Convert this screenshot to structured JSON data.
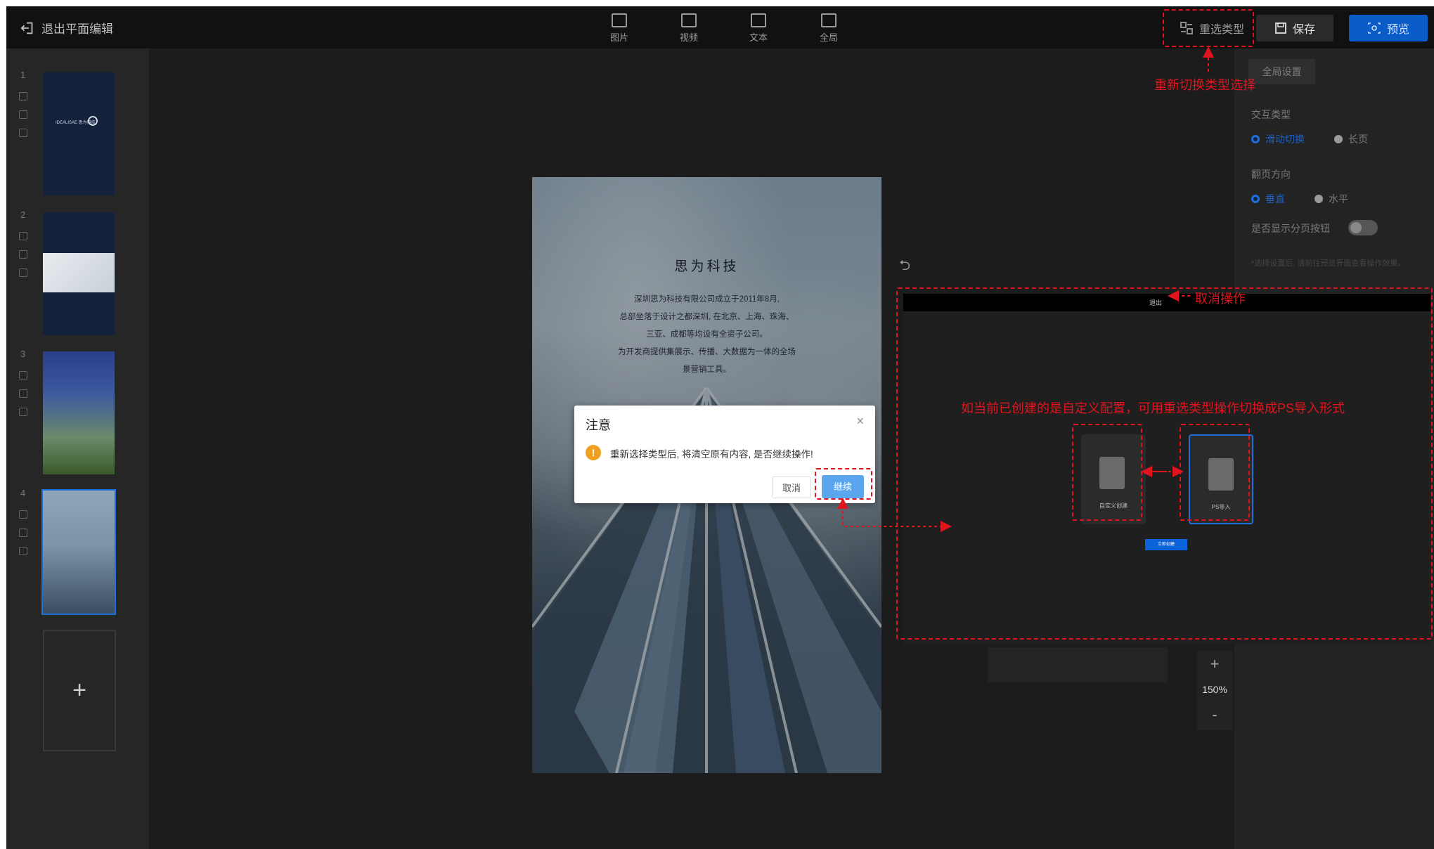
{
  "topbar": {
    "exit_label": "退出平面编辑",
    "tools": [
      {
        "label": "图片",
        "icon": "image-icon"
      },
      {
        "label": "视频",
        "icon": "video-icon"
      },
      {
        "label": "文本",
        "icon": "text-icon"
      },
      {
        "label": "全局",
        "icon": "global-icon"
      }
    ],
    "switch_type_label": "重选类型",
    "save_label": "保存",
    "preview_label": "预览"
  },
  "pages": [
    {
      "num": "1",
      "brand": "IDEALISAE 思为科技"
    },
    {
      "num": "2"
    },
    {
      "num": "3"
    },
    {
      "num": "4"
    }
  ],
  "add_page_symbol": "+",
  "canvas": {
    "title": "思为科技",
    "lines": [
      "深圳思为科技有限公司成立于2011年8月,",
      "总部坐落于设计之都深圳, 在北京、上海、珠海、",
      "三亚、成都等均设有全资子公司。",
      "为开发商提供集展示、传播、大数据为一体的全场",
      "景营销工具。"
    ],
    "undo_symbol": "⮌"
  },
  "modal": {
    "title": "注意",
    "message": "重新选择类型后, 将清空原有内容, 是否继续操作!",
    "cancel_label": "取消",
    "confirm_label": "继续",
    "warn_symbol": "!",
    "close_symbol": "×"
  },
  "right_panel": {
    "tab_label": "全局设置",
    "interaction_label": "交互类型",
    "interaction_options": [
      "滑动切换",
      "长页"
    ],
    "direction_label": "翻页方向",
    "direction_options": [
      "垂直",
      "水平"
    ],
    "pager_label": "是否显示分页按钮",
    "hint": "*选择设置后, 请前往预览界面查看操作效果。"
  },
  "zoom": {
    "plus": "+",
    "value": "150%",
    "minus": "-"
  },
  "preview": {
    "exit_label": "退出",
    "card_custom": "自定义创建",
    "card_ps": "PS导入",
    "start_button": "立即创建"
  },
  "annotations": {
    "switch_type": "重新切换类型选择",
    "cancel_op": "取消操作",
    "custom_note": "如当前已创建的是自定义配置，可用重选类型操作切换成PS导入形式"
  },
  "colors": {
    "annotation": "#e1141e",
    "accent": "#1e6fd9",
    "preview_button": "#0b5cc9"
  }
}
